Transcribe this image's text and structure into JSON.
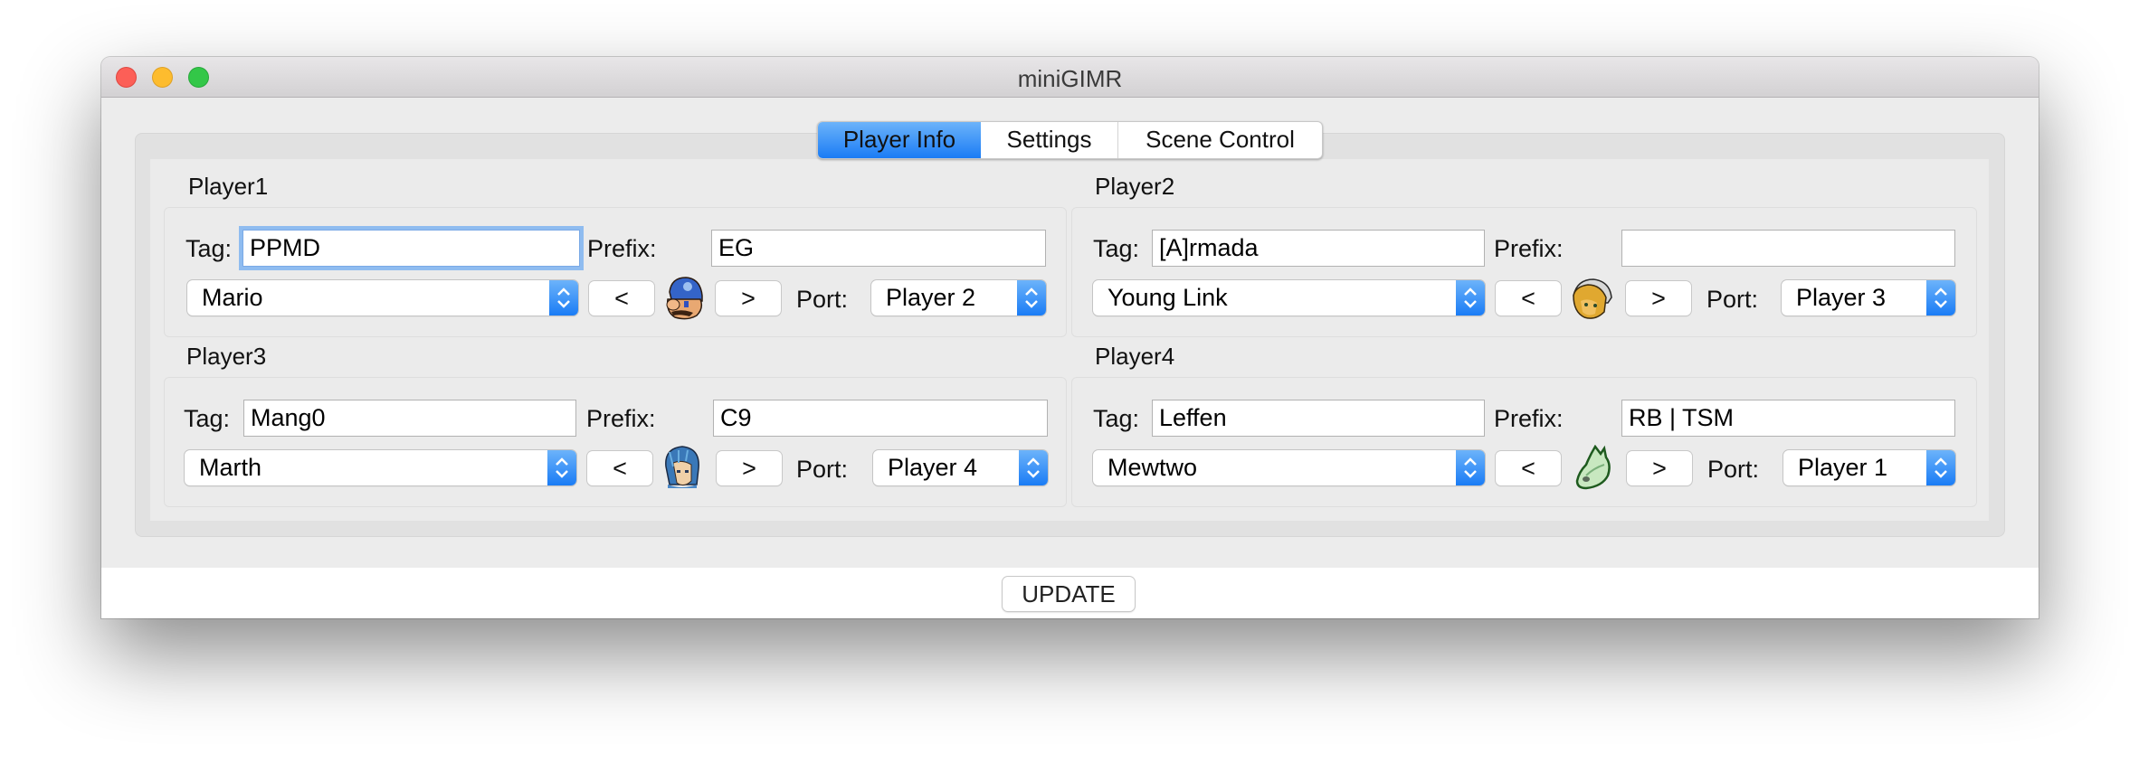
{
  "window": {
    "title": "miniGIMR",
    "controls": [
      "close",
      "minimize",
      "zoom"
    ]
  },
  "tabs": [
    {
      "label": "Player Info",
      "active": true
    },
    {
      "label": "Settings",
      "active": false
    },
    {
      "label": "Scene Control",
      "active": false
    }
  ],
  "labels": {
    "tag": "Tag:",
    "prefix": "Prefix:",
    "port": "Port:",
    "prev": "<",
    "next": ">"
  },
  "players": [
    {
      "title": "Player1",
      "tag": "PPMD",
      "prefix": "EG",
      "character": "Mario",
      "character_icon": "mario-icon",
      "port": "Player 2",
      "tag_focused": true
    },
    {
      "title": "Player2",
      "tag": "[A]rmada",
      "prefix": "",
      "character": "Young Link",
      "character_icon": "young-link-icon",
      "port": "Player 3",
      "tag_focused": false
    },
    {
      "title": "Player3",
      "tag": "Mang0",
      "prefix": "C9",
      "character": "Marth",
      "character_icon": "marth-icon",
      "port": "Player 4",
      "tag_focused": false
    },
    {
      "title": "Player4",
      "tag": "Leffen",
      "prefix": "RB | TSM",
      "character": "Mewtwo",
      "character_icon": "mewtwo-icon",
      "port": "Player 1",
      "tag_focused": false
    }
  ],
  "footer": {
    "update_label": "UPDATE"
  },
  "colors": {
    "accent_top": "#6cb3fa",
    "accent_bottom": "#1a7cf5",
    "focus_ring": "#8fbcf0"
  }
}
